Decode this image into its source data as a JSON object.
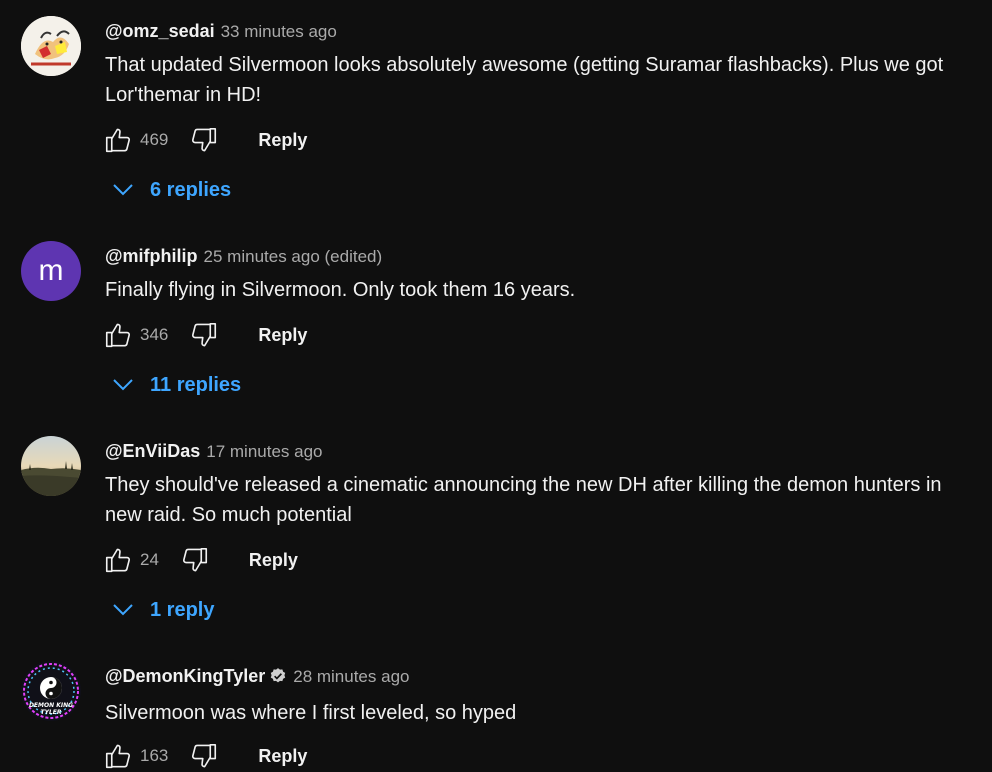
{
  "comments": [
    {
      "author": "@omz_sedai",
      "time": "33 minutes ago",
      "text": "That updated Silvermoon looks absolutely awesome (getting Suramar flashbacks). Plus we got Lor'themar in HD!",
      "likes": "469",
      "reply_label": "Reply",
      "replies_label": "6 replies"
    },
    {
      "author": "@mifphilip",
      "avatar_letter": "m",
      "time": "25 minutes ago (edited)",
      "text": "Finally flying in Silvermoon. Only took them 16 years.",
      "likes": "346",
      "reply_label": "Reply",
      "replies_label": "11 replies"
    },
    {
      "author": "@EnViiDas",
      "time": "17 minutes ago",
      "text": "They should've released a cinematic announcing the new DH after killing the demon hunters in new raid.  So much potential",
      "likes": "24",
      "reply_label": "Reply",
      "replies_label": "1 reply"
    },
    {
      "author": "@DemonKingTyler",
      "time": "28 minutes ago",
      "text": "Silvermoon was where I first leveled, so hyped",
      "likes": "163",
      "reply_label": "Reply",
      "avatar_text": "DEMON KING TYLER"
    }
  ],
  "colors": {
    "background": "#0f0f0f",
    "link_blue": "#3ea6ff",
    "avatar_purple": "#5e35b1",
    "secondary_text": "#aaaaaa"
  },
  "icons": {
    "like": "thumbs-up-icon",
    "dislike": "thumbs-down-icon",
    "expand": "chevron-down-icon",
    "verified": "verified-badge-icon"
  }
}
